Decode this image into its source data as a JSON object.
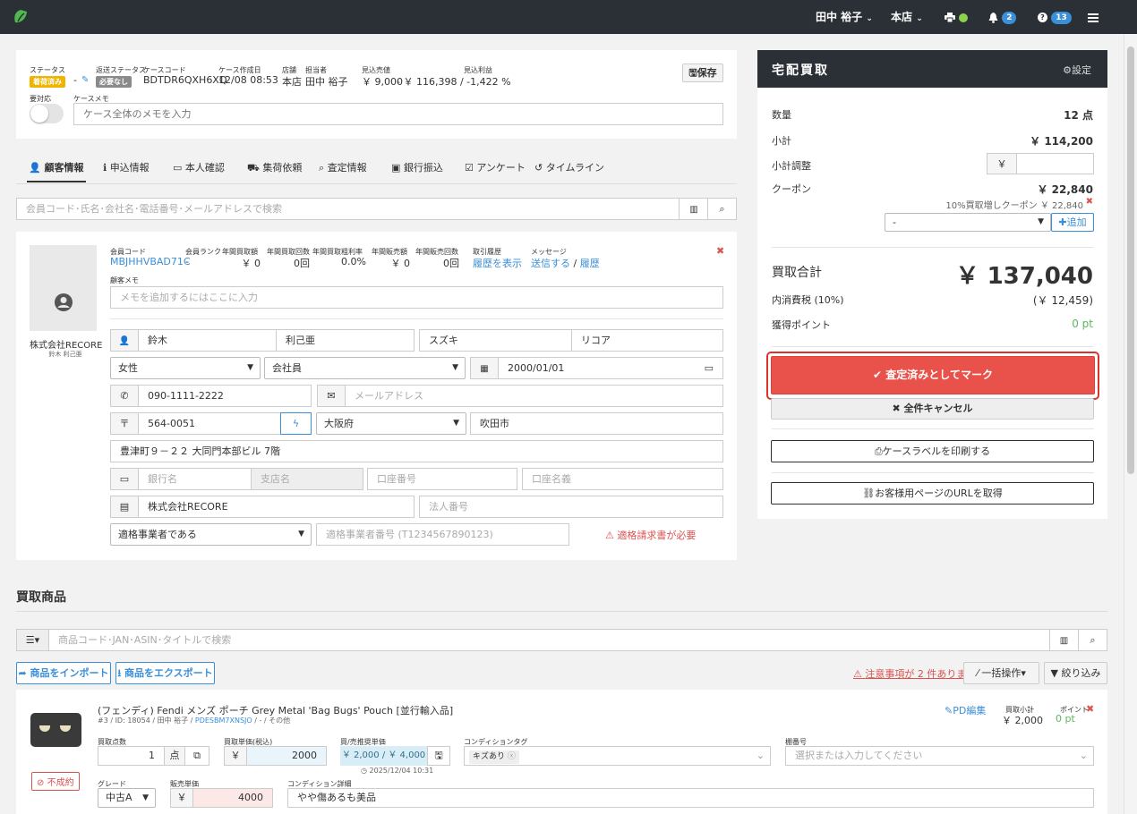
{
  "topbar": {
    "user": "田中 裕子",
    "store": "本店",
    "notifications_count": "2",
    "help_count": "13"
  },
  "case": {
    "status_label": "ステータス",
    "status_value": "着荷済み",
    "shipping_status_label": "返送ステータス",
    "shipping_status_value": "必要なし",
    "code_label": "ケースコード",
    "code_value": "BDTDR6QXH6XQ",
    "created_label": "ケース作成日",
    "created_value": "12/08 08:53",
    "store_label": "店舗",
    "store_value": "本店",
    "staff_label": "担当者",
    "staff_value": "田中 裕子",
    "est_sales_label": "見込売値",
    "est_sales_value": "￥ 9,000",
    "est_profit_label": "見込利益",
    "est_profit_value": "- ￥ 116,398 / -1,422 %",
    "dash": "-",
    "save_label": "保存",
    "attention_label": "要対応",
    "memo_label": "ケースメモ",
    "memo_placeholder": "ケース全体のメモを入力"
  },
  "tabs": [
    "顧客情報",
    "申込情報",
    "本人確認",
    "集荷依頼",
    "査定情報",
    "銀行振込",
    "アンケート",
    "タイムライン"
  ],
  "customer_search_placeholder": "会員コード･氏名･会社名･電話番号･メールアドレスで検索",
  "customer": {
    "company": "株式会社RECORE",
    "person": "鈴木 利己亜",
    "member_code_label": "会員コード",
    "member_code": "MBJHHVBAD71C",
    "rank_label": "会員ランク",
    "rank_value": "-",
    "annual_buy_amount_label": "年間買取額",
    "annual_buy_amount": "￥ 0",
    "annual_buy_count_label": "年間買取回数",
    "annual_buy_count": "0回",
    "annual_margin_label": "年間買取粗利率",
    "annual_margin": "0.0%",
    "annual_sales_amount_label": "年間販売額",
    "annual_sales_amount": "￥ 0",
    "annual_sales_count_label": "年間販売回数",
    "annual_sales_count": "0回",
    "history_label": "取引履歴",
    "history_link": "履歴を表示",
    "message_label": "メッセージ",
    "message_send": "送信する",
    "message_sep": "/",
    "message_history": "履歴",
    "memo_label": "顧客メモ",
    "memo_placeholder": "メモを追加するにはここに入力",
    "last_name": "鈴木",
    "first_name": "利己亜",
    "last_kana": "スズキ",
    "first_kana": "リコア",
    "gender": "女性",
    "occupation": "会社員",
    "birthday": "2000/01/01",
    "phone": "090-1111-2222",
    "email_placeholder": "メールアドレス",
    "zip": "564-0051",
    "prefecture": "大阪府",
    "city": "吹田市",
    "address": "豊津町９－２２ 大同門本部ビル 7階",
    "bank_placeholder": "銀行名",
    "branch_placeholder": "支店名",
    "account_no_placeholder": "口座番号",
    "account_name_placeholder": "口座名義",
    "company_field": "株式会社RECORE",
    "corp_no_placeholder": "法人番号",
    "invoice_status": "適格事業者である",
    "invoice_no_placeholder": "適格事業者番号 (T1234567890123)",
    "invoice_warning": "適格請求書が必要"
  },
  "purchase": {
    "title": "宅配買取",
    "settings": "設定",
    "qty_label": "数量",
    "qty_value": "12 点",
    "subtotal_label": "小計",
    "subtotal_value": "￥ 114,200",
    "adjust_label": "小計調整",
    "yen": "￥",
    "coupon_label": "クーポン",
    "coupon_value": "￥ 22,840",
    "coupon_detail": "10%買取増しクーポン ￥ 22,840",
    "coupon_select": "-",
    "add_label": "追加",
    "total_label": "買取合計",
    "total_value": "￥ 137,040",
    "tax_label": "内消費税 (10%)",
    "tax_value": "(￥ 12,459)",
    "points_label": "獲得ポイント",
    "points_value": "0 pt",
    "mark_button": "査定済みとしてマーク",
    "cancel_button": "全件キャンセル",
    "print_button": "ケースラベルを印刷する",
    "url_button": "お客様用ページのURLを取得"
  },
  "items_section": {
    "title": "買取商品",
    "search_placeholder": "商品コード･JAN･ASIN･タイトルで検索",
    "import_label": "商品をインポート",
    "export_label": "商品をエクスポート",
    "warning_label": "注意事項が 2 件あります",
    "bulk_label": "一括操作",
    "filter_label": "絞り込み"
  },
  "item": {
    "title": "(フェンディ) Fendi メンズ ポーチ Grey Metal 'Bag Bugs' Pouch [並行輸入品]",
    "meta_pre": "#3 / ID: 18054 / 田中 裕子 / ",
    "meta_link": "PDESBM7XNSJO",
    "meta_post": " / - / その他",
    "pd_edit": "PD編集",
    "buy_subtotal_label": "買取小計",
    "buy_subtotal": "￥ 2,000",
    "points_label": "ポイント",
    "points": "0 pt",
    "qty_label": "買取点数",
    "qty": "1",
    "unit": "点",
    "unit_price_label": "買取単価(税込)",
    "unit_price": "2000",
    "rec_label": "買/売推奨単価",
    "rec_value": "￥ 2,000 / ￥ 4,000",
    "rec_time": "2025/12/04 10:31",
    "cond_tag_label": "コンディションタグ",
    "cond_tag": "キズあり",
    "shelf_label": "棚番号",
    "shelf_placeholder": "選択または入力してください",
    "failed_label": "不成約",
    "grade_label": "グレード",
    "grade": "中古A",
    "sell_price_label": "販売単価",
    "sell_price": "4000",
    "cond_detail_label": "コンディション詳細",
    "cond_detail": "やや傷あるも美品"
  },
  "colors": {
    "topbar": "#2a3036",
    "accent_blue": "#3a8fd8",
    "danger": "#e9524a",
    "status_yellow": "#f0b400",
    "success_green": "#5cb85c"
  }
}
